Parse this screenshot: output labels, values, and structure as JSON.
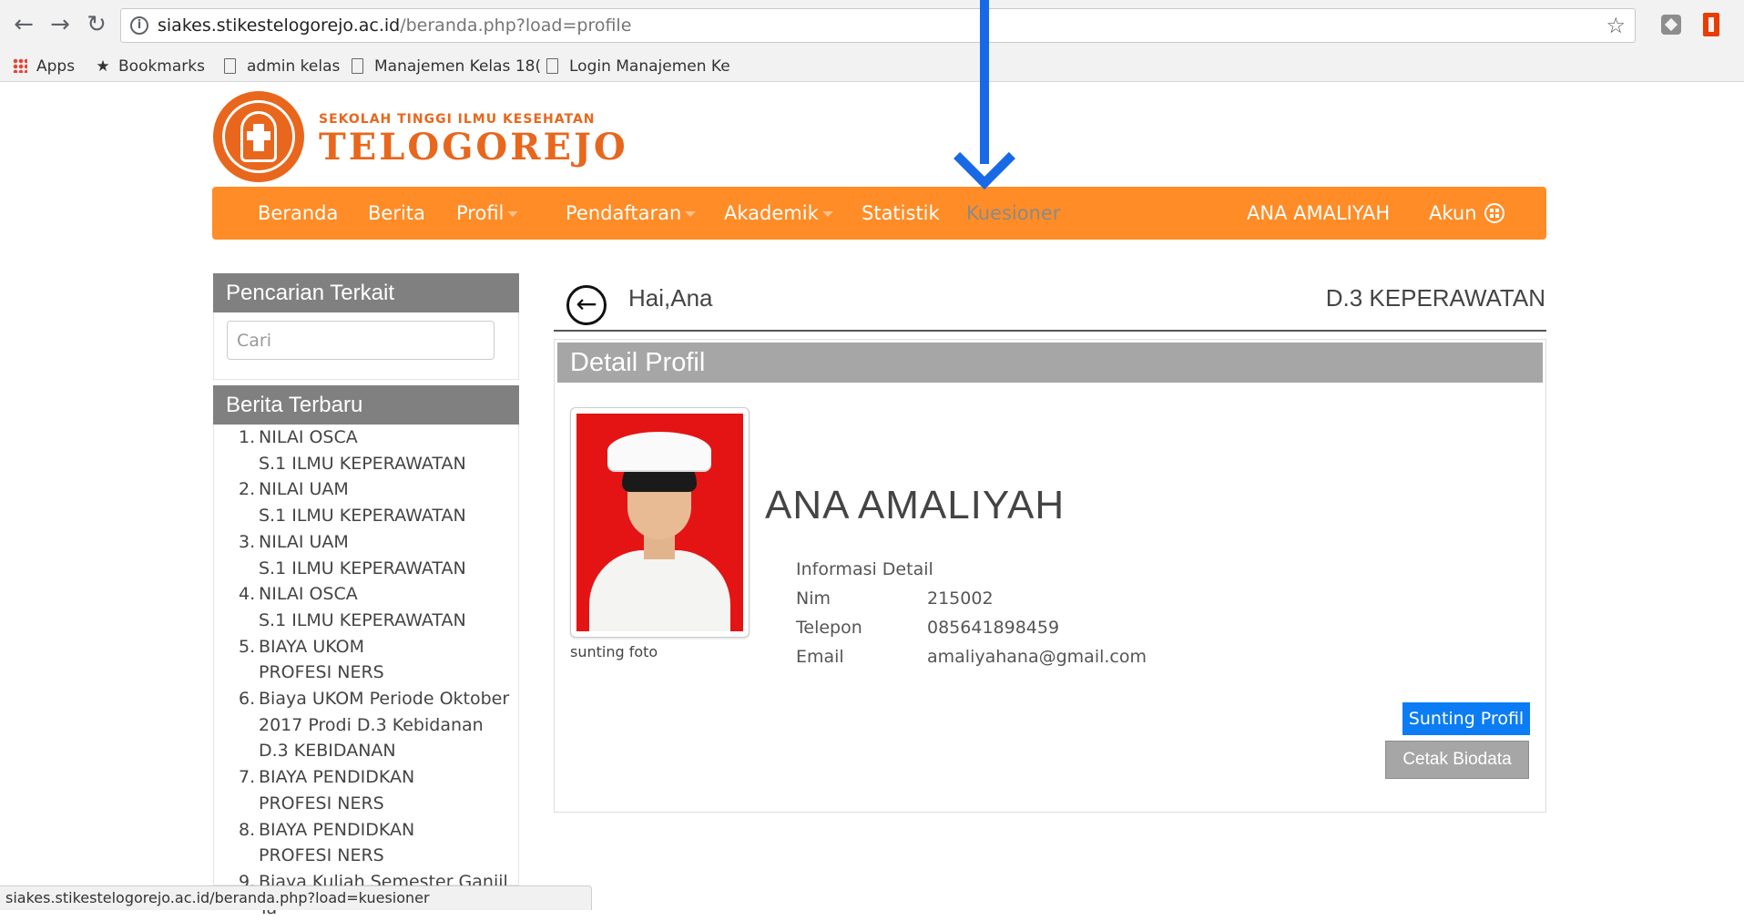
{
  "browser": {
    "url_host": "siakes.stikestelogorejo.ac.id",
    "url_path": "/beranda.php?load=profile",
    "bookmarks": [
      "Apps",
      "Bookmarks",
      "admin kelas",
      "Manajemen Kelas 18(",
      "Login Manajemen Ke"
    ],
    "status_url": "siakes.stikestelogorejo.ac.id/beranda.php?load=kuesioner"
  },
  "brand": {
    "subtitle": "SEKOLAH TINGGI ILMU KESEHATAN",
    "title": "TELOGOREJO",
    "color": "#e8671d"
  },
  "annotation": {
    "color": "#1769e5",
    "points_to": "Kuesioner"
  },
  "nav": {
    "items": [
      "Beranda",
      "Berita",
      "Profil",
      "Pendaftaran",
      "Akademik",
      "Statistik",
      "Kuesioner"
    ],
    "user": "ANA AMALIYAH",
    "account": "Akun",
    "color": "#ff8c26"
  },
  "sidebar": {
    "search_title": "Pencarian Terkait",
    "search_placeholder": "Cari",
    "news_title": "Berita Terbaru",
    "news": [
      {
        "num": "1.",
        "title": "NILAI OSCA",
        "category": "S.1 ILMU KEPERAWATAN"
      },
      {
        "num": "2.",
        "title": "NILAI UAM",
        "category": "S.1 ILMU KEPERAWATAN"
      },
      {
        "num": "3.",
        "title": "NILAI UAM",
        "category": "S.1 ILMU KEPERAWATAN"
      },
      {
        "num": "4.",
        "title": "NILAI OSCA",
        "category": "S.1 ILMU KEPERAWATAN"
      },
      {
        "num": "5.",
        "title": "BIAYA UKOM",
        "category": "PROFESI NERS"
      },
      {
        "num": "6.",
        "title": "Biaya UKOM Periode Oktober 2017 Prodi D.3 Kebidanan",
        "category": "D.3 KEBIDANAN"
      },
      {
        "num": "7.",
        "title": "BIAYA PENDIDKAN",
        "category": "PROFESI NERS"
      },
      {
        "num": "8.",
        "title": "BIAYA PENDIDKAN",
        "category": "PROFESI NERS"
      },
      {
        "num": "9.",
        "title": "Biaya Kuliah Semester Ganjil Ta",
        "category": ""
      }
    ]
  },
  "main": {
    "greeting": "Hai,Ana",
    "program": "D.3 KEPERAWATAN",
    "detail_title": "Detail Profil",
    "photo_caption": "sunting foto",
    "name": "ANA AMALIYAH",
    "info_title": "Informasi Detail",
    "fields": [
      {
        "label": "Nim",
        "value": "215002"
      },
      {
        "label": "Telepon",
        "value": "085641898459"
      },
      {
        "label": "Email",
        "value": "amaliyahana@gmail.com"
      }
    ],
    "edit_button": "Sunting Profil",
    "print_button": "Cetak Biodata"
  }
}
